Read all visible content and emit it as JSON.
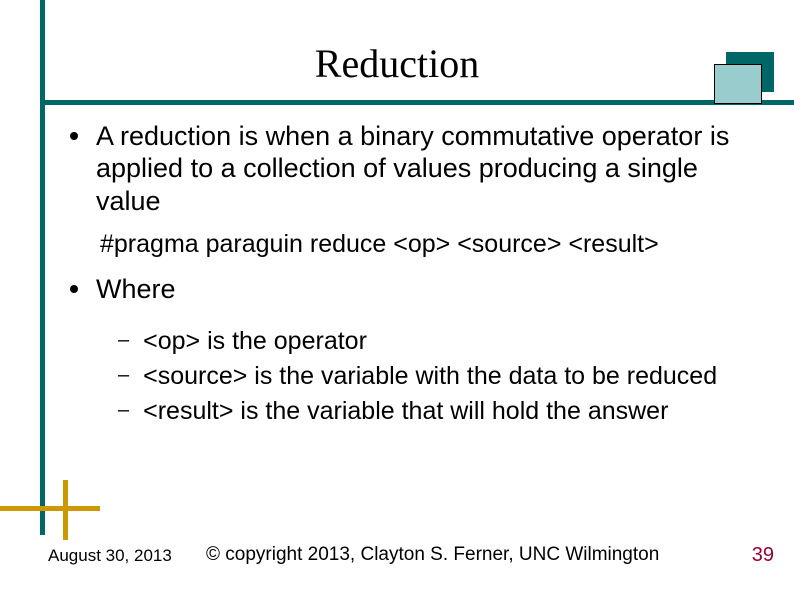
{
  "title": "Reduction",
  "bullets": {
    "b1": "A reduction is when a binary commutative operator is applied to a collection of values producing a single value",
    "pragma": "#pragma paraguin reduce <op> <source> <result>",
    "b2": "Where",
    "sub1": "<op> is the operator",
    "sub2": "<source> is the variable with the data to be reduced",
    "sub3": "<result> is the variable that will hold the answer"
  },
  "footer": {
    "date": "August 30, 2013",
    "copyright": "© copyright 2013, Clayton S. Ferner, UNC Wilmington",
    "page": "39"
  }
}
